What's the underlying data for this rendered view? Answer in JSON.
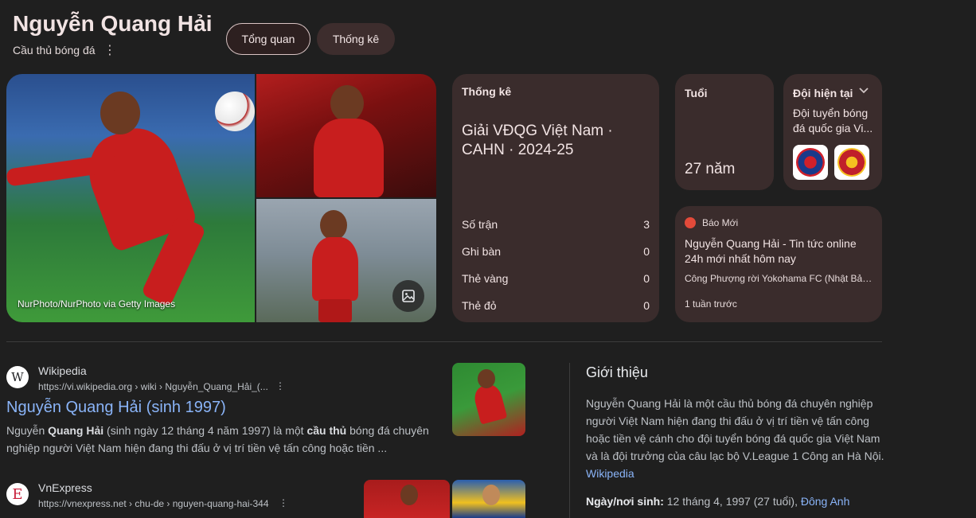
{
  "header": {
    "title": "Nguyễn Quang Hải",
    "subtitle": "Cầu thủ bóng đá",
    "more_icon": "⋮",
    "chips": [
      "Tổng quan",
      "Thống kê"
    ]
  },
  "images": {
    "credit": "NurPhoto/NurPhoto via Getty Images"
  },
  "stats": {
    "title": "Thống kê",
    "league": "Giải VĐQG Việt Nam · CAHN · 2024-25",
    "rows": [
      {
        "label": "Số trận",
        "value": "3"
      },
      {
        "label": "Ghi bàn",
        "value": "0"
      },
      {
        "label": "Thẻ vàng",
        "value": "0"
      },
      {
        "label": "Thẻ đỏ",
        "value": "0"
      }
    ]
  },
  "age": {
    "label": "Tuổi",
    "value": "27 năm"
  },
  "team": {
    "label": "Đội hiện tại",
    "name": "Đội tuyển bóng đá quốc gia Vi..."
  },
  "news": {
    "source": "Báo Mới",
    "title": "Nguyễn Quang Hải - Tin tức online 24h mới nhất hôm nay",
    "subtitle": "Công Phượng rời Yokohama FC (Nhật Bản)...",
    "time": "1 tuần trước"
  },
  "results": [
    {
      "favicon": "W",
      "site": "Wikipedia",
      "url": "https://vi.wikipedia.org › wiki › Nguyễn_Quang_Hải_(...",
      "title": "Nguyễn Quang Hải (sinh 1997)",
      "snippet_1": "Nguyễn ",
      "snippet_b1": "Quang Hải",
      "snippet_2": " (sinh ngày 12 tháng 4 năm 1997) là một ",
      "snippet_b2": "cầu thủ",
      "snippet_3": " bóng đá chuyên nghiệp người Việt Nam hiện đang thi đấu ở vị trí tiền vệ tấn công hoặc tiền ..."
    },
    {
      "favicon": "E",
      "site": "VnExpress",
      "url": "https://vnexpress.net › chu-de › nguyen-quang-hai-344"
    }
  ],
  "about": {
    "title": "Giới thiệu",
    "text": "Nguyễn Quang Hải là một cầu thủ bóng đá chuyên nghiệp người Việt Nam hiện đang thi đấu ở vị trí tiền vệ tấn công hoặc tiền vệ cánh cho đội tuyển bóng đá quốc gia Việt Nam và là đội trưởng của câu lạc bộ V.League 1 Công an Hà Nội. ",
    "link": "Wikipedia",
    "born_label": "Ngày/nơi sinh:",
    "born_value": " 12 tháng 4, 1997 (27 tuổi), ",
    "born_link": "Đông Anh"
  }
}
